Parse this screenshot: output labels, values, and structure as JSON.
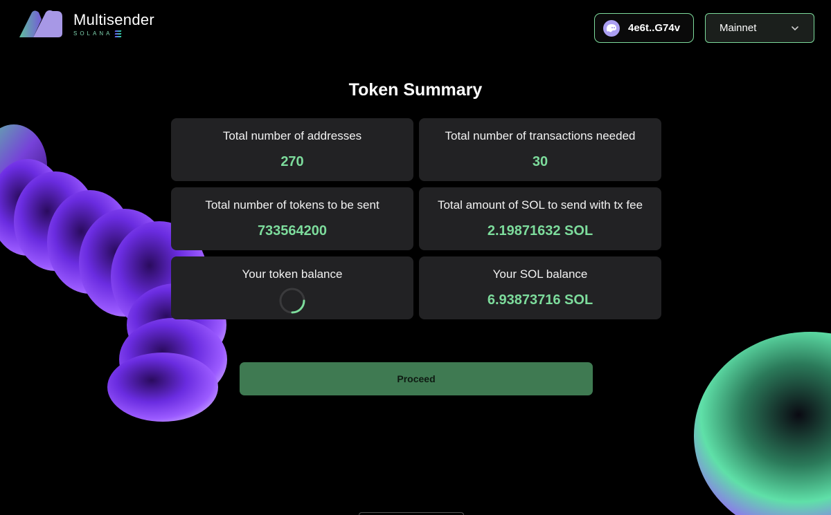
{
  "header": {
    "brand_title": "Multisender",
    "brand_subtitle": "SOLANA",
    "wallet_label": "4e6t..G74v",
    "network_label": "Mainnet",
    "icons": [
      "logo-mark",
      "phantom-ghost-icon",
      "chevron-down-icon"
    ]
  },
  "summary": {
    "title": "Token Summary",
    "cards": [
      {
        "label": "Total number of addresses",
        "value": "270"
      },
      {
        "label": "Total number of transactions needed",
        "value": "30"
      },
      {
        "label": "Total number of tokens to be sent",
        "value": "733564200"
      },
      {
        "label": "Total amount of SOL to send with tx fee",
        "value": "2.19871632 SOL"
      },
      {
        "label": "Your token balance",
        "value": ""
      },
      {
        "label": "Your SOL balance",
        "value": "6.93873716 SOL"
      }
    ]
  },
  "actions": {
    "proceed_label": "Proceed"
  },
  "colors": {
    "accent": "#7ddc9c",
    "card_bg": "#222224",
    "button_bg": "#3f7a52"
  }
}
